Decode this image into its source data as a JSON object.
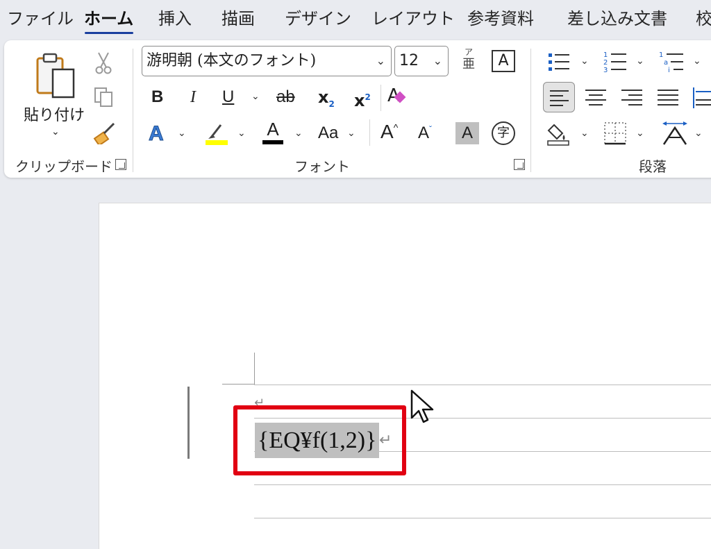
{
  "menu": {
    "tabs": [
      {
        "label": "ファイル",
        "active": false
      },
      {
        "label": "ホーム",
        "active": true
      },
      {
        "label": "挿入",
        "active": false
      },
      {
        "label": "描画",
        "active": false
      },
      {
        "label": "デザイン",
        "active": false
      },
      {
        "label": "レイアウト",
        "active": false
      },
      {
        "label": "参考資料",
        "active": false
      },
      {
        "label": "差し込み文書",
        "active": false
      },
      {
        "label": "校",
        "active": false
      }
    ]
  },
  "clipboard": {
    "paste_label": "貼り付け",
    "group_label": "クリップボード"
  },
  "font": {
    "font_name": "游明朝 (本文のフォント)",
    "font_size": "12",
    "furigana_top": "ア",
    "furigana_bottom": "亜",
    "bold": "B",
    "italic": "I",
    "underline": "U",
    "strike": "ab",
    "subscript_base": "x",
    "subscript_mark": "2",
    "superscript_base": "x",
    "superscript_mark": "2",
    "clear_format": "A",
    "change_case": "Aa",
    "grow": "A",
    "shrink": "A",
    "char_shading": "A",
    "enclosed_char": "字",
    "text_effect": "A",
    "font_color": "A",
    "char_border": "A",
    "group_label": "フォント",
    "highlight_color": "#ffff00",
    "font_color_value": "#000000"
  },
  "paragraph": {
    "group_label": "段落"
  },
  "document": {
    "field_code": "{EQ¥f(1,2)}",
    "paragraph_mark": "↵"
  }
}
